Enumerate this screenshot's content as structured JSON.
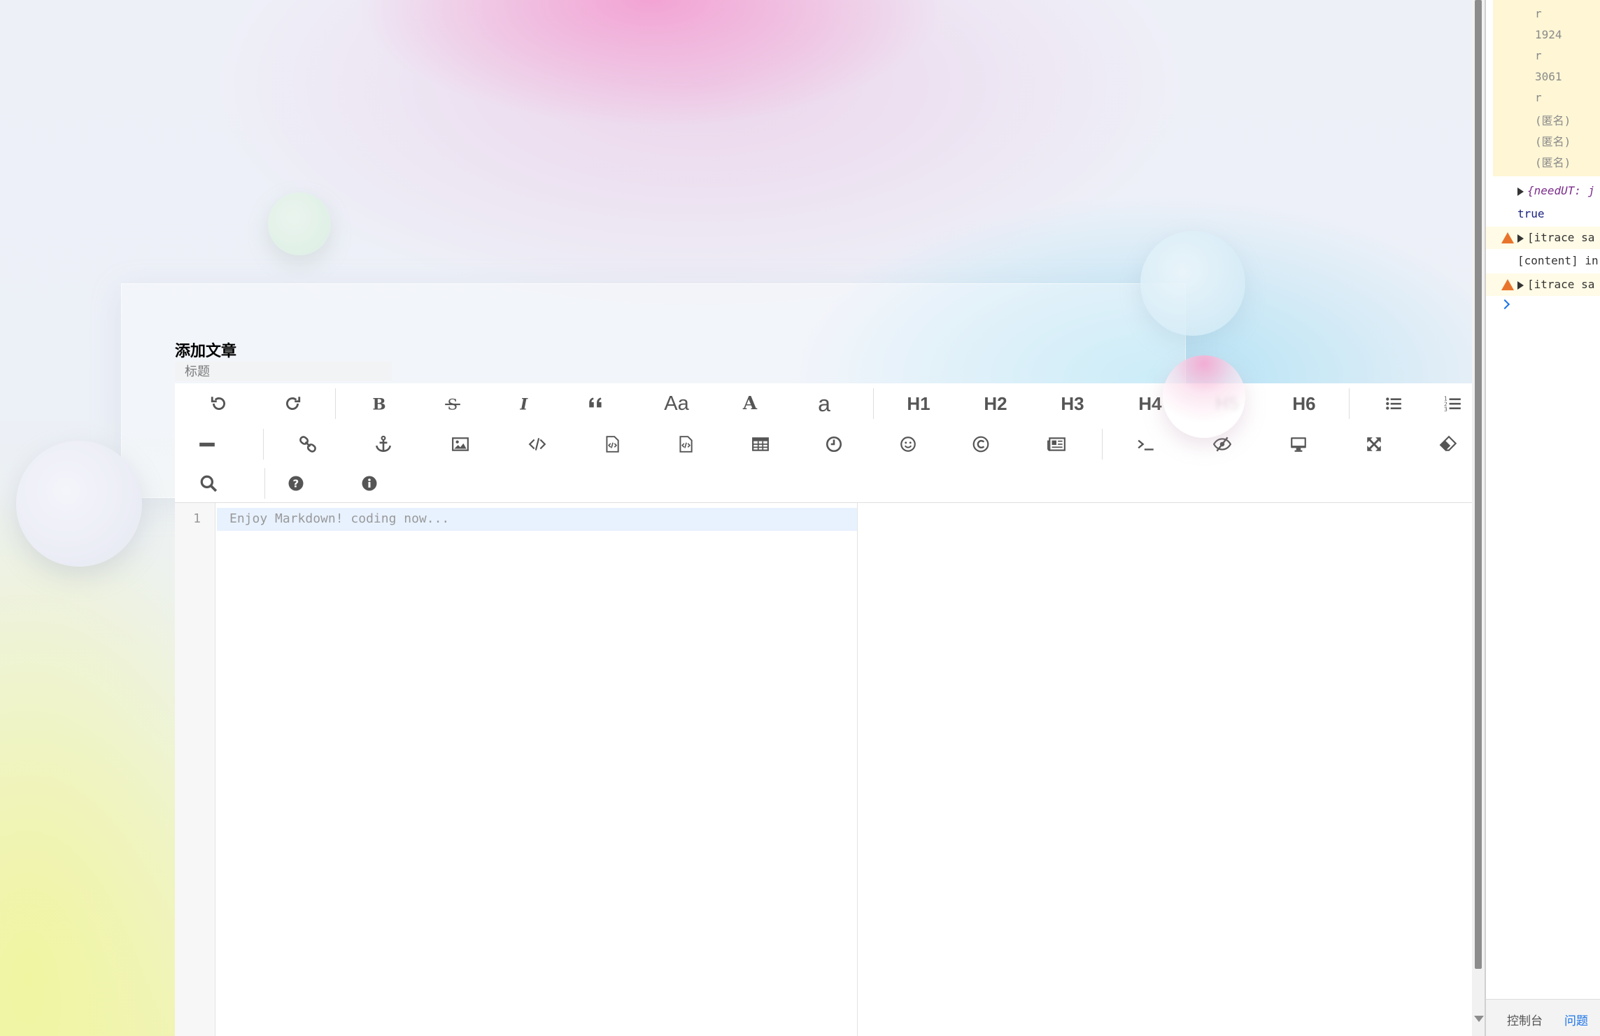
{
  "page": {
    "heading": "添加文章",
    "title_placeholder": "标题"
  },
  "toolbar": {
    "row1": [
      {
        "name": "undo-button",
        "icon": "undo-icon"
      },
      {
        "name": "redo-button",
        "icon": "redo-icon"
      },
      {
        "name": "bold-button",
        "icon": "bold-icon"
      },
      {
        "name": "strikethrough-button",
        "icon": "strikethrough-icon"
      },
      {
        "name": "italic-button",
        "icon": "italic-icon"
      },
      {
        "name": "quote-button",
        "icon": "quote-icon"
      },
      {
        "name": "uppercase-button",
        "label": "Aa"
      },
      {
        "name": "first-uppercase-button",
        "label": "A"
      },
      {
        "name": "lowercase-button",
        "label": "a"
      },
      {
        "name": "h1-button",
        "label": "H1"
      },
      {
        "name": "h2-button",
        "label": "H2"
      },
      {
        "name": "h3-button",
        "label": "H3"
      },
      {
        "name": "h4-button",
        "label": "H4"
      },
      {
        "name": "h5-button",
        "label": "H5"
      },
      {
        "name": "h6-button",
        "label": "H6"
      },
      {
        "name": "unordered-list-button",
        "icon": "list-ul-icon"
      },
      {
        "name": "ordered-list-button",
        "icon": "list-ol-icon"
      }
    ],
    "row2": [
      {
        "name": "horizontal-rule-button",
        "icon": "minus-icon"
      },
      {
        "name": "link-button",
        "icon": "link-icon"
      },
      {
        "name": "anchor-button",
        "icon": "anchor-icon"
      },
      {
        "name": "image-button",
        "icon": "image-icon"
      },
      {
        "name": "inline-code-button",
        "icon": "code-icon"
      },
      {
        "name": "code-block-button",
        "icon": "file-code-icon"
      },
      {
        "name": "preformatted-button",
        "icon": "file-code-icon"
      },
      {
        "name": "table-button",
        "icon": "table-icon"
      },
      {
        "name": "datetime-button",
        "icon": "clock-icon"
      },
      {
        "name": "emoji-button",
        "icon": "smile-icon"
      },
      {
        "name": "html-entities-button",
        "icon": "copyright-icon"
      },
      {
        "name": "pagebreak-button",
        "icon": "newspaper-icon"
      },
      {
        "name": "goto-line-button",
        "icon": "terminal-icon"
      },
      {
        "name": "watch-toggle-button",
        "icon": "eye-slash-icon"
      },
      {
        "name": "preview-button",
        "icon": "desktop-icon"
      },
      {
        "name": "fullscreen-button",
        "icon": "expand-icon"
      },
      {
        "name": "clear-button",
        "icon": "eraser-icon"
      }
    ],
    "row3": [
      {
        "name": "search-button",
        "icon": "search-icon"
      },
      {
        "name": "help-button",
        "icon": "question-circle-icon"
      },
      {
        "name": "info-button",
        "icon": "info-circle-icon"
      }
    ]
  },
  "editor": {
    "line_number": "1",
    "placeholder": "Enjoy Markdown! coding now..."
  },
  "devtools": {
    "stack_lines": [
      "r",
      "1924",
      "r",
      "3061",
      "r",
      "(匿名)",
      "(匿名)",
      "(匿名)"
    ],
    "object_preview": "{needUT: j",
    "value_true": "true",
    "warning_1": "[itrace sa",
    "content_line": "[content] in",
    "warning_2": "[itrace sa",
    "tabs": [
      "控制台",
      "问题"
    ],
    "colors": {
      "warning": "#e8742b",
      "active_tab": "#1a73e8",
      "stack_bg": "#fef6d5"
    }
  }
}
